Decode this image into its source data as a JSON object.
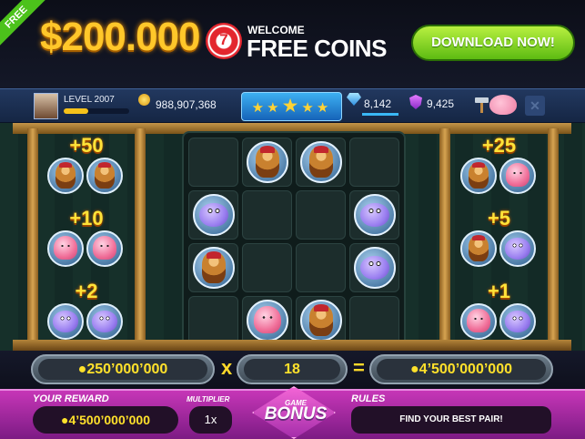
{
  "banner": {
    "ribbon": "FREE",
    "amount": "$200.000",
    "chip_number": "7",
    "welcome": "WELCOME",
    "free_coins": "FREE COINS",
    "download_label": "DOWNLOAD NOW!"
  },
  "status": {
    "level": "LEVEL 2007",
    "level_progress": 0.38,
    "coins": "988,907,368",
    "stars": "★★",
    "star_center": "★",
    "stars_right": "★★",
    "gems": "8,142",
    "shields": "9,425",
    "close": "✕"
  },
  "left_panel": {
    "rows": [
      {
        "multiplier": "+50",
        "symbol": "pirate"
      },
      {
        "multiplier": "+10",
        "symbol": "octopus"
      },
      {
        "multiplier": "+2",
        "symbol": "fish"
      }
    ]
  },
  "right_panel": {
    "rows": [
      {
        "multiplier": "+25",
        "symbols": [
          "pirate",
          "octopus"
        ]
      },
      {
        "multiplier": "+5",
        "symbols": [
          "pirate",
          "fish"
        ]
      },
      {
        "multiplier": "+1",
        "symbols": [
          "octopus",
          "fish"
        ]
      }
    ]
  },
  "grid": [
    [
      "",
      "pirate",
      "pirate",
      ""
    ],
    [
      "fish",
      "",
      "",
      "fish"
    ],
    [
      "pirate",
      "",
      "",
      "fish"
    ],
    [
      "",
      "octopus",
      "pirate",
      ""
    ]
  ],
  "formula": {
    "bet": "●250’000’000",
    "times": "x",
    "multiplier": "18",
    "equals": "=",
    "result": "●4’500’000’000"
  },
  "bottom": {
    "reward_label": "YOUR REWARD",
    "reward_value": "●4’500’000’000",
    "multiplier_label": "MULTIPLIER",
    "multiplier_value": "1x",
    "bonus_small": "GAME",
    "bonus_word": "BONUS",
    "rules_label": "RULES",
    "rules_text": "FIND YOUR BEST PAIR!"
  },
  "colors": {
    "gold": "#ffc72a",
    "download_green": "#5dbb12",
    "bottom_magenta": "#c636b7"
  }
}
